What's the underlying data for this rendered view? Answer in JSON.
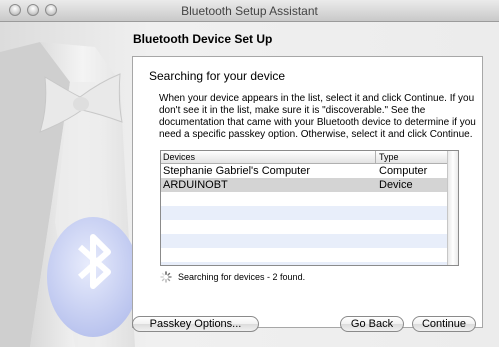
{
  "window": {
    "title": "Bluetooth Setup Assistant"
  },
  "heading": "Bluetooth Device Set Up",
  "panel": {
    "title": "Searching for your device",
    "description": "When your device appears in the list, select it and click Continue. If you don't see it in the list, make sure it is \"discoverable.\" See the documentation that came with your Bluetooth device to determine if you need a specific passkey option. Otherwise, select it and click Continue."
  },
  "table": {
    "columns": [
      "Devices",
      "Type"
    ],
    "rows": [
      {
        "device": "Stephanie Gabriel's Computer",
        "type": "Computer"
      },
      {
        "device": "ARDUINOBT",
        "type": "Device",
        "selected": true
      }
    ],
    "empty_rows": 6
  },
  "status": {
    "text": "Searching for devices - 2 found."
  },
  "buttons": {
    "passkey": "Passkey Options...",
    "back": "Go Back",
    "continue": "Continue"
  },
  "colors": {
    "selected_row": "#d4d4d4",
    "alt_row": "#e8eefa",
    "bluetooth_badge": "#c7cff2"
  }
}
